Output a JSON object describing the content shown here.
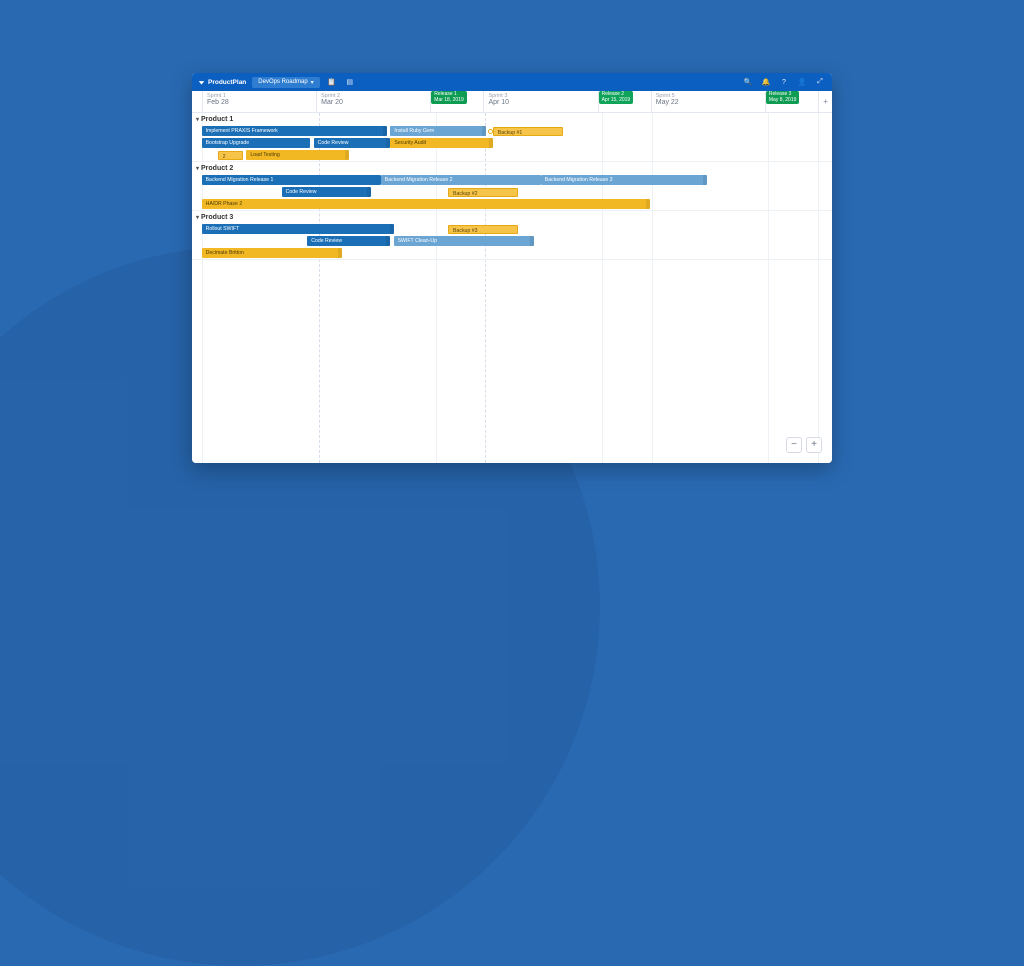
{
  "brand": "ProductPlan",
  "breadcrumb": {
    "label": "DevOps Roadmap"
  },
  "toolbar_icons": {
    "clipboard": "clipboard",
    "layout": "layout"
  },
  "right_icons": {
    "search": "search",
    "bell": "bell",
    "help": "?",
    "user": "user",
    "expand": "expand"
  },
  "columns": [
    {
      "sprint": "Sprint 1",
      "date": "Feb 28",
      "release": null
    },
    {
      "sprint": "Sprint 2",
      "date": "Mar 20",
      "release": null
    },
    {
      "sprint": "",
      "date": "",
      "release": {
        "name": "Release 1",
        "sub": "Mar 18, 2019"
      }
    },
    {
      "sprint": "Sprint 3",
      "date": "Apr 10",
      "release": null
    },
    {
      "sprint": "",
      "date": "",
      "release": {
        "name": "Release 2",
        "sub": "Apr 15, 2019"
      }
    },
    {
      "sprint": "Sprint 5",
      "date": "May 22",
      "release": null
    },
    {
      "sprint": "",
      "date": "",
      "release": {
        "name": "Release 3",
        "sub": "May 8, 2019"
      }
    }
  ],
  "groups": {
    "g1": {
      "name": "Product 1",
      "r1": {
        "a": "Implement PRAXIS Framework",
        "b": "Install Ruby Gem",
        "c": "Backup #1"
      },
      "r2": {
        "a": "Bootstrap Upgrade",
        "b": "Code Review",
        "c": "Security Audit"
      },
      "r3": {
        "a": "2",
        "b": "Load Testing"
      }
    },
    "g2": {
      "name": "Product 2",
      "r1": {
        "a": "Backend Migration Release 1",
        "b": "Backend Migration Release 2",
        "c": "Backend Migration Release 3"
      },
      "r2": {
        "a": "Code Review",
        "b": "Backup #2"
      },
      "r3": {
        "a": "HA/DR Phase 2"
      }
    },
    "g3": {
      "name": "Product 3",
      "r1": {
        "a": "Rollout SWIFT",
        "b": "Backup #3"
      },
      "r2": {
        "a": "Code Review",
        "b": "SWIFT Clean-Up"
      },
      "r3": {
        "a": "Decimate Britton"
      }
    }
  },
  "zoom": {
    "out": "−",
    "in": "+"
  }
}
